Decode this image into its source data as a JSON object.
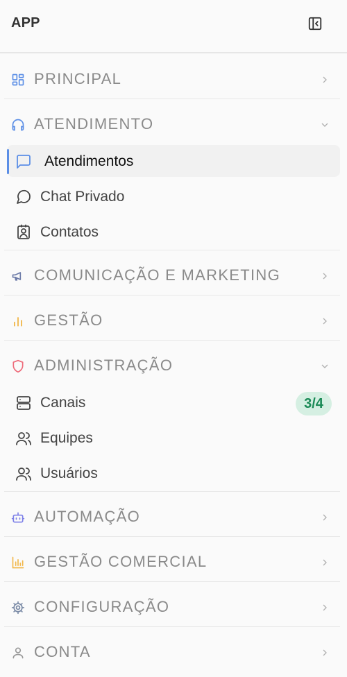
{
  "app": {
    "title": "APP"
  },
  "sections": [
    {
      "label": "PRINCIPAL",
      "icon": "grid-icon",
      "color": "#5b8ee6",
      "expanded": false
    },
    {
      "label": "ATENDIMENTO",
      "icon": "headphones-icon",
      "color": "#5b8ee6",
      "expanded": true,
      "items": [
        {
          "label": "Atendimentos",
          "icon": "message-square-icon",
          "active": true
        },
        {
          "label": "Chat Privado",
          "icon": "message-circle-icon",
          "active": false
        },
        {
          "label": "Contatos",
          "icon": "contact-icon",
          "active": false
        }
      ]
    },
    {
      "label": "COMUNICAÇÃO E MARKETING",
      "icon": "megaphone-icon",
      "color": "#6c7ba8",
      "expanded": false
    },
    {
      "label": "GESTÃO",
      "icon": "bar-chart-icon",
      "color": "#f2b84b",
      "expanded": false
    },
    {
      "label": "ADMINISTRAÇÃO",
      "icon": "shield-icon",
      "color": "#ee6b7a",
      "expanded": true,
      "items": [
        {
          "label": "Canais",
          "icon": "server-icon",
          "active": false,
          "badge": "3/4"
        },
        {
          "label": "Equipes",
          "icon": "users-icon",
          "active": false
        },
        {
          "label": "Usuários",
          "icon": "users-icon",
          "active": false
        }
      ]
    },
    {
      "label": "AUTOMAÇÃO",
      "icon": "bot-icon",
      "color": "#7d80e8",
      "expanded": false
    },
    {
      "label": "GESTÃO COMERCIAL",
      "icon": "chart-bars-icon",
      "color": "#f2b84b",
      "expanded": false
    },
    {
      "label": "CONFIGURAÇÃO",
      "icon": "gear-icon",
      "color": "#7a8aa6",
      "expanded": false
    },
    {
      "label": "CONTA",
      "icon": "user-icon",
      "color": "#999999",
      "expanded": false
    }
  ],
  "colors": {
    "accent": "#5b8ee6",
    "badge_bg": "#d5efe2",
    "badge_text": "#1a8a56"
  }
}
